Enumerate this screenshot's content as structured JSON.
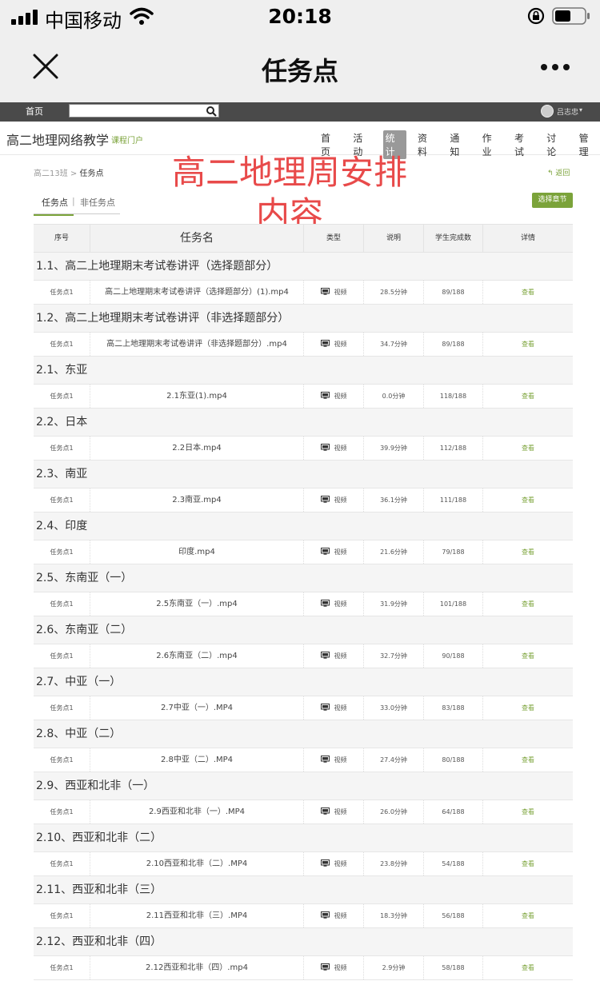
{
  "status": {
    "carrier": "中国移动",
    "time": "20:18"
  },
  "wechat": {
    "title": "任务点"
  },
  "site": {
    "home": "首页",
    "search_placeholder": "",
    "user": "吕志忠"
  },
  "course": {
    "name": "高二地理网络教学",
    "portal": "课程门户",
    "nav": [
      "首页",
      "活动",
      "统计",
      "资料",
      "通知",
      "作业",
      "考试",
      "讨论",
      "管理"
    ],
    "active_nav": "统计"
  },
  "crumb": {
    "class": "高二13班",
    "sep": " > ",
    "current": "任务点"
  },
  "back": "返回",
  "watermark": {
    "line1": "高二地理周安排",
    "line2": "内容"
  },
  "tabs": {
    "active": "任务点",
    "sep": "|",
    "other": "非任务点"
  },
  "choose_chapter": "选择章节",
  "headers": [
    "序号",
    "任务名",
    "类型",
    "说明",
    "学生完成数",
    "详情"
  ],
  "groups": [
    {
      "chapter": "1.1、高二上地理期末考试卷讲评（选择题部分）",
      "task": "任务点1",
      "name": "高二上地理期末考试卷讲评（选择题部分）(1).mp4",
      "type": "视频",
      "note": "28.5分钟",
      "done": "89/188",
      "view": "查看"
    },
    {
      "chapter": "1.2、高二上地理期末考试卷讲评（非选择题部分）",
      "task": "任务点1",
      "name": "高二上地理期末考试卷讲评（非选择题部分）.mp4",
      "type": "视频",
      "note": "34.7分钟",
      "done": "89/188",
      "view": "查看"
    },
    {
      "chapter": "2.1、东亚",
      "task": "任务点1",
      "name": "2.1东亚(1).mp4",
      "type": "视频",
      "note": "0.0分钟",
      "done": "118/188",
      "view": "查看"
    },
    {
      "chapter": "2.2、日本",
      "task": "任务点1",
      "name": "2.2日本.mp4",
      "type": "视频",
      "note": "39.9分钟",
      "done": "112/188",
      "view": "查看"
    },
    {
      "chapter": "2.3、南亚",
      "task": "任务点1",
      "name": "2.3南亚.mp4",
      "type": "视频",
      "note": "36.1分钟",
      "done": "111/188",
      "view": "查看"
    },
    {
      "chapter": "2.4、印度",
      "task": "任务点1",
      "name": "印度.mp4",
      "type": "视频",
      "note": "21.6分钟",
      "done": "79/188",
      "view": "查看"
    },
    {
      "chapter": "2.5、东南亚（一）",
      "task": "任务点1",
      "name": "2.5东南亚（一）.mp4",
      "type": "视频",
      "note": "31.9分钟",
      "done": "101/188",
      "view": "查看"
    },
    {
      "chapter": "2.6、东南亚（二）",
      "task": "任务点1",
      "name": "2.6东南亚（二）.mp4",
      "type": "视频",
      "note": "32.7分钟",
      "done": "90/188",
      "view": "查看"
    },
    {
      "chapter": "2.7、中亚（一）",
      "task": "任务点1",
      "name": "2.7中亚（一）.MP4",
      "type": "视频",
      "note": "33.0分钟",
      "done": "83/188",
      "view": "查看"
    },
    {
      "chapter": "2.8、中亚（二）",
      "task": "任务点1",
      "name": "2.8中亚（二）.MP4",
      "type": "视频",
      "note": "27.4分钟",
      "done": "80/188",
      "view": "查看"
    },
    {
      "chapter": "2.9、西亚和北非（一）",
      "task": "任务点1",
      "name": "2.9西亚和北非（一）.MP4",
      "type": "视频",
      "note": "26.0分钟",
      "done": "64/188",
      "view": "查看"
    },
    {
      "chapter": "2.10、西亚和北非（二）",
      "task": "任务点1",
      "name": "2.10西亚和北非（二）.MP4",
      "type": "视频",
      "note": "23.8分钟",
      "done": "54/188",
      "view": "查看"
    },
    {
      "chapter": "2.11、西亚和北非（三）",
      "task": "任务点1",
      "name": "2.11西亚和北非（三）.MP4",
      "type": "视频",
      "note": "18.3分钟",
      "done": "56/188",
      "view": "查看"
    },
    {
      "chapter": "2.12、西亚和北非（四）",
      "task": "任务点1",
      "name": "2.12西亚和北非（四）.mp4",
      "type": "视频",
      "note": "2.9分钟",
      "done": "58/188",
      "view": "查看"
    }
  ],
  "colors": {
    "accent": "#7ba33a",
    "watermark": "#e84a4a",
    "topbar": "#4a4a4a"
  }
}
